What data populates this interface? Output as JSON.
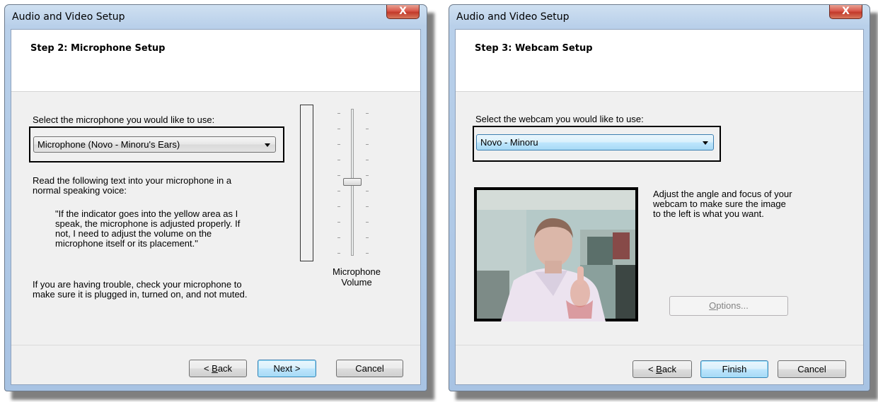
{
  "dialog1": {
    "title": "Audio and Video Setup",
    "close_glyph": "X",
    "step_title": "Step 2: Microphone Setup",
    "select_label": "Select the microphone you would like to use:",
    "microphone_value": "Microphone (Novo - Minoru's Ears)",
    "instruction_line1": "Read the following text into your microphone in a",
    "instruction_line2": "normal speaking voice:",
    "quote_line1": "\"If the indicator goes into the yellow area as I",
    "quote_line2": "speak, the microphone is adjusted properly.  If",
    "quote_line3": "not, I need to adjust the volume on the",
    "quote_line4": "microphone itself or its placement.\"",
    "trouble_line1": "If you are having trouble, check your microphone to",
    "trouble_line2": "make sure it is plugged in, turned on, and not muted.",
    "volume_label_line1": "Microphone",
    "volume_label_line2": "Volume",
    "volume_level": 0.5,
    "buttons": {
      "back_pre": "< ",
      "back_u": "B",
      "back_post": "ack",
      "next": "Next >",
      "cancel": "Cancel"
    }
  },
  "dialog2": {
    "title": "Audio and Video Setup",
    "close_glyph": "X",
    "step_title": "Step 3: Webcam Setup",
    "select_label": "Select the webcam you would like to use:",
    "webcam_value": "Novo - Minoru",
    "adjust_line1": "Adjust the angle and focus of your",
    "adjust_line2": "webcam to make sure the image",
    "adjust_line3": "to the left is what you want.",
    "options_u": "O",
    "options_post": "ptions...",
    "buttons": {
      "back_pre": "< ",
      "back_u": "B",
      "back_post": "ack",
      "finish": "Finish",
      "cancel": "Cancel"
    }
  }
}
